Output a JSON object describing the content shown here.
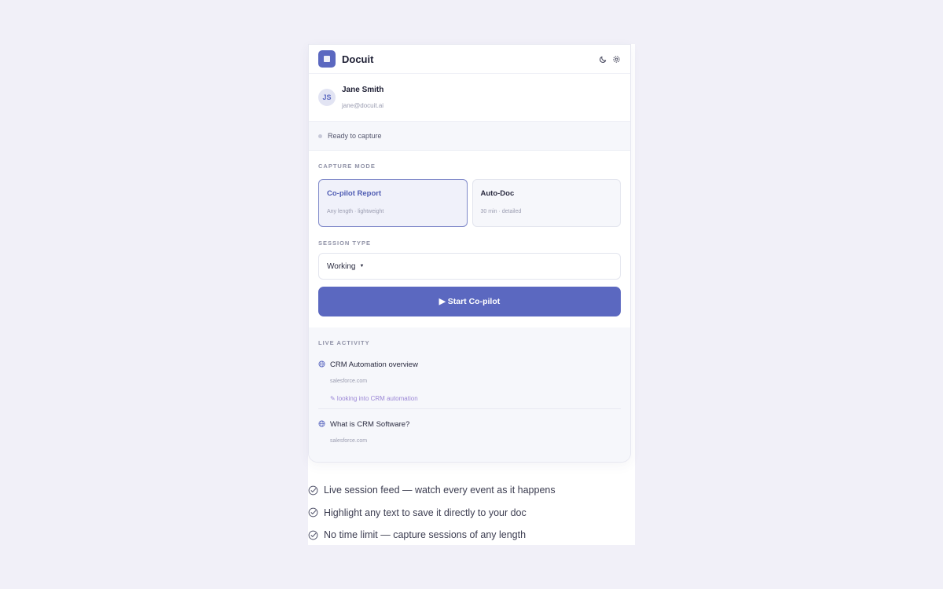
{
  "app": {
    "name": "Docuit"
  },
  "header": {
    "icons": [
      "moon-icon",
      "gear-icon"
    ]
  },
  "user": {
    "initials": "JS",
    "name": "Jane Smith",
    "email": "jane@docuit.ai"
  },
  "status": {
    "text": "Ready to capture"
  },
  "capture_mode": {
    "label": "CAPTURE MODE",
    "options": [
      {
        "title": "Co-pilot Report",
        "subtitle": "Any length · lightweight",
        "selected": true
      },
      {
        "title": "Auto-Doc",
        "subtitle": "30 min · detailed",
        "selected": false
      }
    ]
  },
  "session_type": {
    "label": "SESSION TYPE",
    "value": "Working",
    "caret": "▼"
  },
  "start_button": {
    "label": "▶ Start Co-pilot"
  },
  "live_activity": {
    "label": "LIVE ACTIVITY",
    "items": [
      {
        "title": "CRM Automation overview",
        "url": "salesforce.com",
        "note": "✎ looking into CRM automation"
      },
      {
        "title": "What is CRM Software?",
        "url": "salesforce.com"
      }
    ]
  },
  "features": [
    "Live session feed — watch every event as it happens",
    "Highlight any text to save it directly to your doc",
    "No time limit — capture sessions of any length"
  ],
  "colors": {
    "accent": "#5b68c0",
    "note": "#9b87d6",
    "background": "#f1f0f8"
  }
}
